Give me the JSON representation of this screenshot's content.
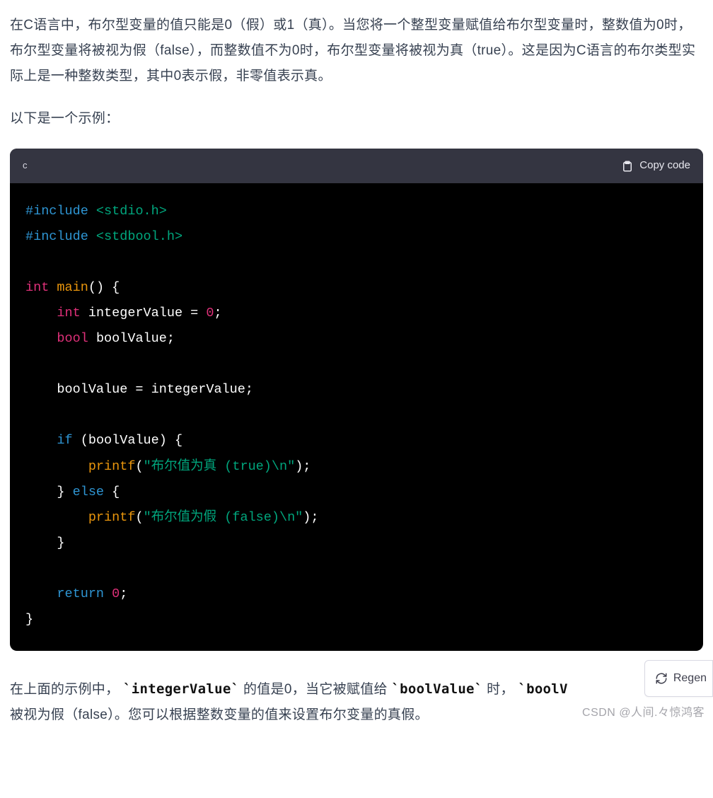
{
  "para1": "在C语言中，布尔型变量的值只能是0（假）或1（真）。当您将一个整型变量赋值给布尔型变量时，整数值为0时，布尔型变量将被视为假（false），而整数值不为0时，布尔型变量将被视为真（true）。这是因为C语言的布尔类型实际上是一种整数类型，其中0表示假，非零值表示真。",
  "para2": "以下是一个示例：",
  "code": {
    "lang": "c",
    "copy_label": "Copy code",
    "tokens": {
      "inc": "#include",
      "h1": " <stdio.h>",
      "h2": " <stdbool.h>",
      "int": "int",
      "main": "main",
      "paren_brace": "() {",
      "bool": "bool",
      "intVar": " integerValue = ",
      "zero": "0",
      "sc": ";",
      "boolVar": " boolValue;",
      "assign": "    boolValue = integerValue;",
      "if": "if",
      "ifcond": " (boolValue) {",
      "printf": "printf",
      "s1": "\"布尔值为真 (true)\\n\"",
      "callend": ");",
      "else": "else",
      "elsebr": " {",
      "s2": "\"布尔值为假 (false)\\n\"",
      "closebr": "    }",
      "return": "return",
      "retv": " 0",
      "semicolon2": ";",
      "endbr": "}"
    }
  },
  "para3": {
    "p0": "在上面的示例中，",
    "c1": "`integerValue`",
    "p1": " 的值是0，当它被赋值给 ",
    "c2": "`boolValue`",
    "p2": " 时，",
    "c3": "`boolV",
    "p3": "被视为假（false）。您可以根据整数变量的值来设置布尔变量的真假。"
  },
  "regen_label": "Regen",
  "watermark": "CSDN @人间.々惊鸿客"
}
